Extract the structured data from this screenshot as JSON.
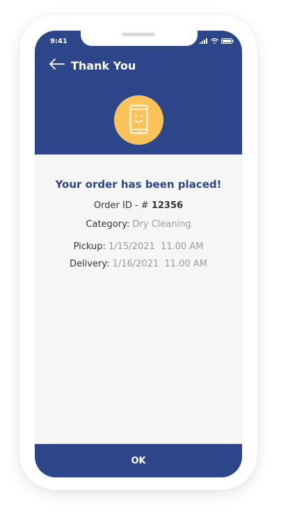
{
  "status_bar": {
    "time": "9:41",
    "icons": [
      "signal-icon",
      "wifi-icon",
      "battery-icon"
    ]
  },
  "header": {
    "title": "Thank You",
    "back_icon": "arrow-left-icon",
    "illustration_icon": "smiling-phone-icon"
  },
  "order": {
    "headline": "Your order has been placed!",
    "id_label": "Order ID - #",
    "id_value": "12356",
    "category_label": "Category:",
    "category_value": "Dry Cleaning",
    "pickup_label": "Pickup:",
    "pickup_value": "1/15/2021  11.00 AM",
    "delivery_label": "Delivery:",
    "delivery_value": "1/16/2021  11.00 AM"
  },
  "footer": {
    "ok_label": "OK"
  },
  "colors": {
    "primary": "#2d4689",
    "accent": "#fbc25a",
    "muted_text": "#9a9a9a",
    "background": "#f6f6f6"
  }
}
